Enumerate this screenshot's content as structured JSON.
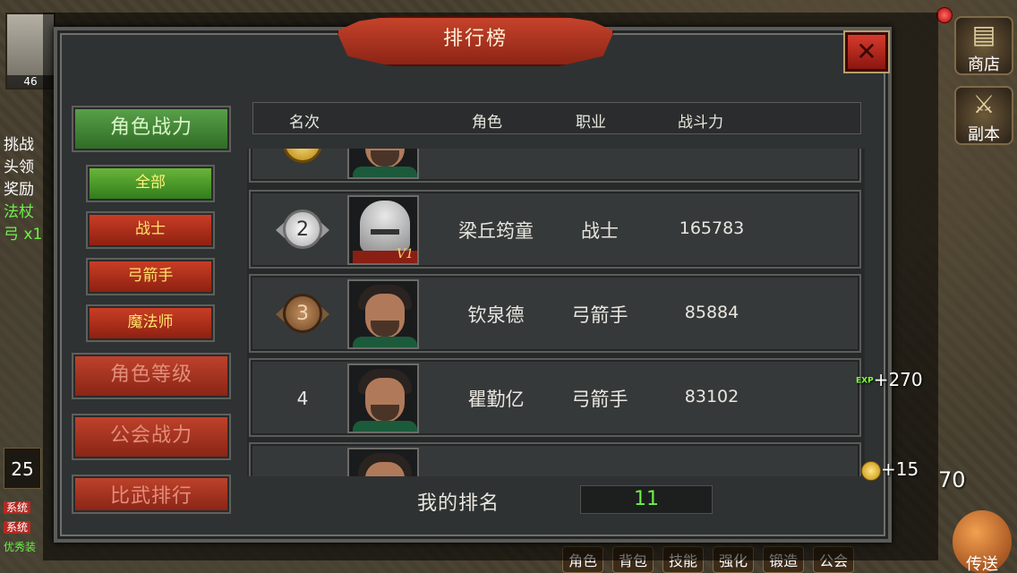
{
  "title": "排行榜",
  "close_icon": "✕",
  "categories": [
    {
      "label": "角色战力",
      "active": true
    },
    {
      "label": "角色等级",
      "active": false
    },
    {
      "label": "公会战力",
      "active": false
    },
    {
      "label": "比武排行",
      "active": false
    }
  ],
  "filters": [
    {
      "label": "全部",
      "active": true
    },
    {
      "label": "战士",
      "active": false
    },
    {
      "label": "弓箭手",
      "active": false
    },
    {
      "label": "魔法师",
      "active": false
    }
  ],
  "columns": {
    "rank": "名次",
    "role": "角色",
    "job": "职业",
    "power": "战斗力"
  },
  "rows": [
    {
      "rank": "2",
      "medal": "silver",
      "avatar": "warrior",
      "vip": "V1",
      "name": "梁丘筠童",
      "job": "战士",
      "power": "165783"
    },
    {
      "rank": "3",
      "medal": "bronze",
      "avatar": "archer",
      "name": "钦泉德",
      "job": "弓箭手",
      "power": "85884"
    },
    {
      "rank": "4",
      "medal": "none",
      "avatar": "archer",
      "name": "瞿勤亿",
      "job": "弓箭手",
      "power": "83102"
    }
  ],
  "my_rank": {
    "label": "我的排名",
    "value": "11"
  },
  "hud": {
    "player_level_short": "46",
    "left_log": [
      "挑战",
      "头领",
      "奖励",
      "法杖",
      "弓 x1"
    ],
    "level_box": "25",
    "sys_tag": "系统",
    "sys_line3": "优秀装",
    "shop": "商店",
    "dungeon": "副本",
    "exp_tag": "EXP",
    "exp_gain": "+270",
    "coin_gain": "+15",
    "gold_partial": "70",
    "bottom_menu": [
      "角色",
      "背包",
      "技能",
      "强化",
      "锻造",
      "公会"
    ],
    "teleport": "传送"
  }
}
